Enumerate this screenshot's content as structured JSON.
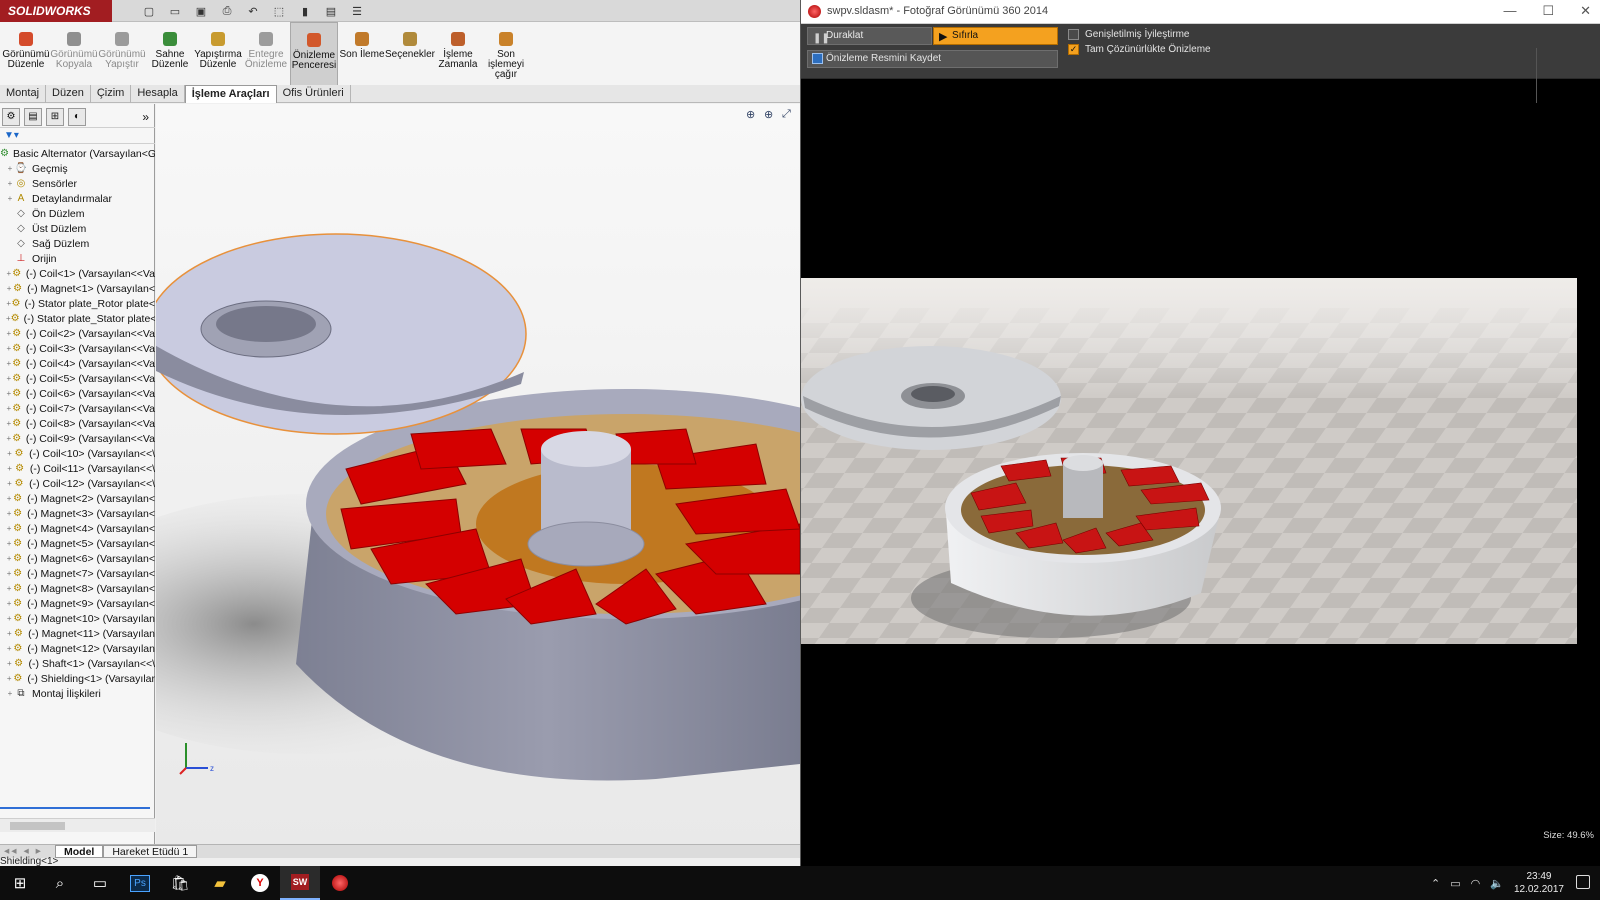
{
  "solidworks": {
    "logo": "SOLIDWORKS",
    "commands": [
      {
        "label": "Görünümü Düzenle",
        "enabled": true,
        "color": "#d44b2b"
      },
      {
        "label": "Görünümü Kopyala",
        "enabled": false,
        "color": "#8f8f8f"
      },
      {
        "label": "Görünümü Yapıştır",
        "enabled": false,
        "color": "#9b9b9b"
      },
      {
        "label": "Sahne Düzenle",
        "enabled": true,
        "color": "#3a8d3a"
      },
      {
        "label": "Yapıştırma Düzenle",
        "enabled": true,
        "color": "#c89b2f"
      },
      {
        "label": "Entegre Önizleme",
        "enabled": false,
        "color": "#9c9c9c"
      },
      {
        "label": "Önizleme Penceresi",
        "enabled": true,
        "active": true,
        "color": "#d2582b"
      },
      {
        "label": "Son İleme",
        "enabled": true,
        "color": "#c17a2a"
      },
      {
        "label": "Seçenekler",
        "enabled": true,
        "color": "#b08a3b"
      },
      {
        "label": "İşleme Zamanla",
        "enabled": true,
        "color": "#bd5f2b"
      },
      {
        "label": "Son işlemeyi çağır",
        "enabled": true,
        "color": "#c9822a"
      }
    ],
    "tabs": [
      "Montaj",
      "Düzen",
      "Çizim",
      "Hesapla",
      "İşleme Araçları",
      "Ofis Ürünleri"
    ],
    "active_tab": "İşleme Araçları",
    "tree": [
      {
        "label": "Basic Alternator  (Varsayılan<Gö",
        "icon": "assembly",
        "level": 0
      },
      {
        "label": "Geçmiş",
        "icon": "history",
        "level": 1
      },
      {
        "label": "Sensörler",
        "icon": "sensor",
        "level": 1
      },
      {
        "label": "Detaylandırmalar",
        "icon": "annotation",
        "level": 1
      },
      {
        "label": "Ön Düzlem",
        "icon": "plane",
        "level": 1
      },
      {
        "label": "Üst Düzlem",
        "icon": "plane",
        "level": 1
      },
      {
        "label": "Sağ Düzlem",
        "icon": "plane",
        "level": 1
      },
      {
        "label": "Orijin",
        "icon": "origin",
        "level": 1
      },
      {
        "label": "(-) Coil<1> (Varsayılan<<Va",
        "icon": "part",
        "level": 1
      },
      {
        "label": "(-) Magnet<1> (Varsayılan<",
        "icon": "part",
        "level": 1
      },
      {
        "label": "(-) Stator plate_Rotor plate<",
        "icon": "part",
        "level": 1
      },
      {
        "label": "(-) Stator plate_Stator plate<",
        "icon": "part",
        "level": 1
      },
      {
        "label": "(-) Coil<2> (Varsayılan<<Va",
        "icon": "part",
        "level": 1
      },
      {
        "label": "(-) Coil<3> (Varsayılan<<Va",
        "icon": "part",
        "level": 1
      },
      {
        "label": "(-) Coil<4> (Varsayılan<<Va",
        "icon": "part",
        "level": 1
      },
      {
        "label": "(-) Coil<5> (Varsayılan<<Va",
        "icon": "part",
        "level": 1
      },
      {
        "label": "(-) Coil<6> (Varsayılan<<Va",
        "icon": "part",
        "level": 1
      },
      {
        "label": "(-) Coil<7> (Varsayılan<<Va",
        "icon": "part",
        "level": 1
      },
      {
        "label": "(-) Coil<8> (Varsayılan<<Va",
        "icon": "part",
        "level": 1
      },
      {
        "label": "(-) Coil<9> (Varsayılan<<Va",
        "icon": "part",
        "level": 1
      },
      {
        "label": "(-) Coil<10> (Varsayılan<<\\",
        "icon": "part",
        "level": 1
      },
      {
        "label": "(-) Coil<11> (Varsayılan<<\\",
        "icon": "part",
        "level": 1
      },
      {
        "label": "(-) Coil<12> (Varsayılan<<\\",
        "icon": "part",
        "level": 1
      },
      {
        "label": "(-) Magnet<2> (Varsayılan<",
        "icon": "part",
        "level": 1
      },
      {
        "label": "(-) Magnet<3> (Varsayılan<",
        "icon": "part",
        "level": 1
      },
      {
        "label": "(-) Magnet<4> (Varsayılan<",
        "icon": "part",
        "level": 1
      },
      {
        "label": "(-) Magnet<5> (Varsayılan<",
        "icon": "part",
        "level": 1
      },
      {
        "label": "(-) Magnet<6> (Varsayılan<",
        "icon": "part",
        "level": 1
      },
      {
        "label": "(-) Magnet<7> (Varsayılan<",
        "icon": "part",
        "level": 1
      },
      {
        "label": "(-) Magnet<8> (Varsayılan<",
        "icon": "part",
        "level": 1
      },
      {
        "label": "(-) Magnet<9> (Varsayılan<",
        "icon": "part",
        "level": 1
      },
      {
        "label": "(-) Magnet<10> (Varsayılan",
        "icon": "part",
        "level": 1
      },
      {
        "label": "(-) Magnet<11> (Varsayılan",
        "icon": "part",
        "level": 1
      },
      {
        "label": "(-) Magnet<12> (Varsayılan",
        "icon": "part",
        "level": 1
      },
      {
        "label": "(-) Shaft<1> (Varsayılan<<\\",
        "icon": "part",
        "level": 1
      },
      {
        "label": "(-) Shielding<1> (Varsayılar",
        "icon": "part",
        "level": 1
      },
      {
        "label": "Montaj İlişkileri",
        "icon": "mates",
        "level": 1
      }
    ],
    "bottom_tabs": [
      "Model",
      "Hareket Etüdü 1"
    ],
    "active_bottom_tab": "Model",
    "status": "Shielding<1>"
  },
  "photoview": {
    "title": "swpv.sldasm* - Fotoğraf Görünümü 360 2014",
    "pause_label": "Duraklat",
    "reset_label": "Sıfırla",
    "save_preview_label": "Önizleme Resmini Kaydet",
    "enhanced_option": {
      "label": "Genişletilmiş İyileştirme",
      "checked": false
    },
    "fullres_option": {
      "label": "Tam Çözünürlükte Önizleme",
      "checked": true
    },
    "size_label": "Size: 49.6%"
  },
  "taskbar": {
    "apps": [
      "windows-start",
      "search",
      "task-view",
      "photoshop",
      "store",
      "file-explorer",
      "yandex-browser",
      "solidworks",
      "photoview"
    ],
    "active_app": "solidworks",
    "time": "23:49",
    "date": "12.02.2017"
  },
  "colors": {
    "accent": "#f4a11f",
    "sw_red": "#a21d21",
    "magnet_red": "#d40000"
  }
}
